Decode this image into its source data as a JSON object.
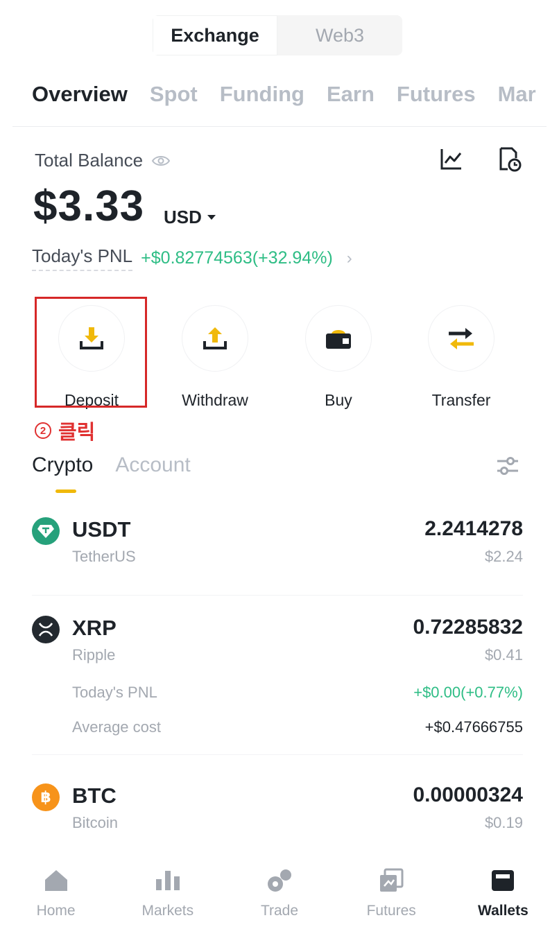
{
  "segment": {
    "exchange": "Exchange",
    "web3": "Web3"
  },
  "wallet_tabs": [
    "Overview",
    "Spot",
    "Funding",
    "Earn",
    "Futures",
    "Mar"
  ],
  "balance": {
    "label": "Total Balance",
    "amount": "$3.33",
    "currency": "USD",
    "pnl_label": "Today's PNL",
    "pnl_value": "+$0.82774563(+32.94%)",
    "pnl_chevron": "›"
  },
  "actions": [
    {
      "label": "Deposit",
      "icon": "deposit-icon"
    },
    {
      "label": "Withdraw",
      "icon": "withdraw-icon"
    },
    {
      "label": "Buy",
      "icon": "wallet-buy-icon"
    },
    {
      "label": "Transfer",
      "icon": "transfer-icon"
    }
  ],
  "annotation": {
    "number": "2",
    "text": "클릭"
  },
  "asset_tabs": [
    "Crypto",
    "Account"
  ],
  "assets": [
    {
      "symbol": "USDT",
      "name": "TetherUS",
      "amount": "2.2414278",
      "usd": "$2.24"
    },
    {
      "symbol": "XRP",
      "name": "Ripple",
      "amount": "0.72285832",
      "usd": "$0.41",
      "pnl_label": "Today's PNL",
      "pnl_value": "+$0.00(+0.77%)",
      "avg_label": "Average cost",
      "avg_value": "+$0.47666755"
    },
    {
      "symbol": "BTC",
      "name": "Bitcoin",
      "amount": "0.00000324",
      "usd": "$0.19"
    }
  ],
  "bottom_nav": [
    {
      "label": "Home",
      "icon": "home-icon"
    },
    {
      "label": "Markets",
      "icon": "markets-icon"
    },
    {
      "label": "Trade",
      "icon": "trade-icon"
    },
    {
      "label": "Futures",
      "icon": "futures-icon"
    },
    {
      "label": "Wallets",
      "icon": "wallets-icon",
      "active": true
    }
  ],
  "colors": {
    "accent": "#f0b90b",
    "positive": "#2ebd85",
    "highlight": "#d62828"
  }
}
